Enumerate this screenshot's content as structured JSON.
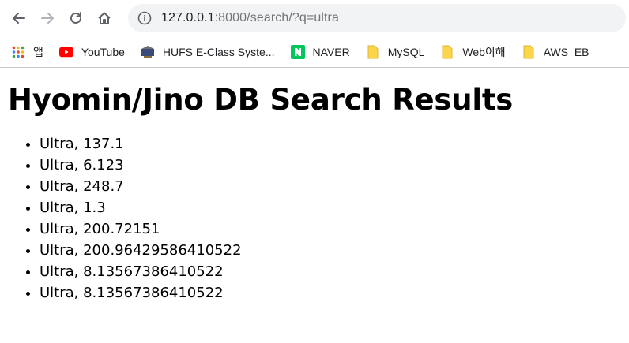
{
  "browser": {
    "url_host": "127.0.0.1",
    "url_path": ":8000/search/?q=ultra",
    "icons": {
      "back": "arrow-left-icon",
      "forward": "arrow-right-icon",
      "reload": "reload-icon",
      "home": "home-icon",
      "site_info": "info-icon"
    }
  },
  "bookmarks": [
    {
      "label": "앱",
      "icon": "apps-grid-icon"
    },
    {
      "label": "YouTube",
      "icon": "youtube-icon"
    },
    {
      "label": "HUFS E-Class Syste...",
      "icon": "hufs-icon"
    },
    {
      "label": "NAVER",
      "icon": "naver-icon"
    },
    {
      "label": "MySQL",
      "icon": "folder-icon"
    },
    {
      "label": "Web이해",
      "icon": "folder-icon"
    },
    {
      "label": "AWS_EB",
      "icon": "folder-icon"
    }
  ],
  "page": {
    "title": "Hyomin/Jino DB Search Results",
    "results": [
      "Ultra, 137.1",
      "Ultra, 6.123",
      "Ultra, 248.7",
      "Ultra, 1.3",
      "Ultra, 200.72151",
      "Ultra, 200.96429586410522",
      "Ultra, 8.13567386410522",
      "Ultra, 8.13567386410522"
    ]
  },
  "colors": {
    "youtube_red": "#ff0000",
    "naver_green": "#03c75a",
    "folder_yellow": "#fbd54a",
    "omnibox_bg": "#f1f3f4"
  }
}
